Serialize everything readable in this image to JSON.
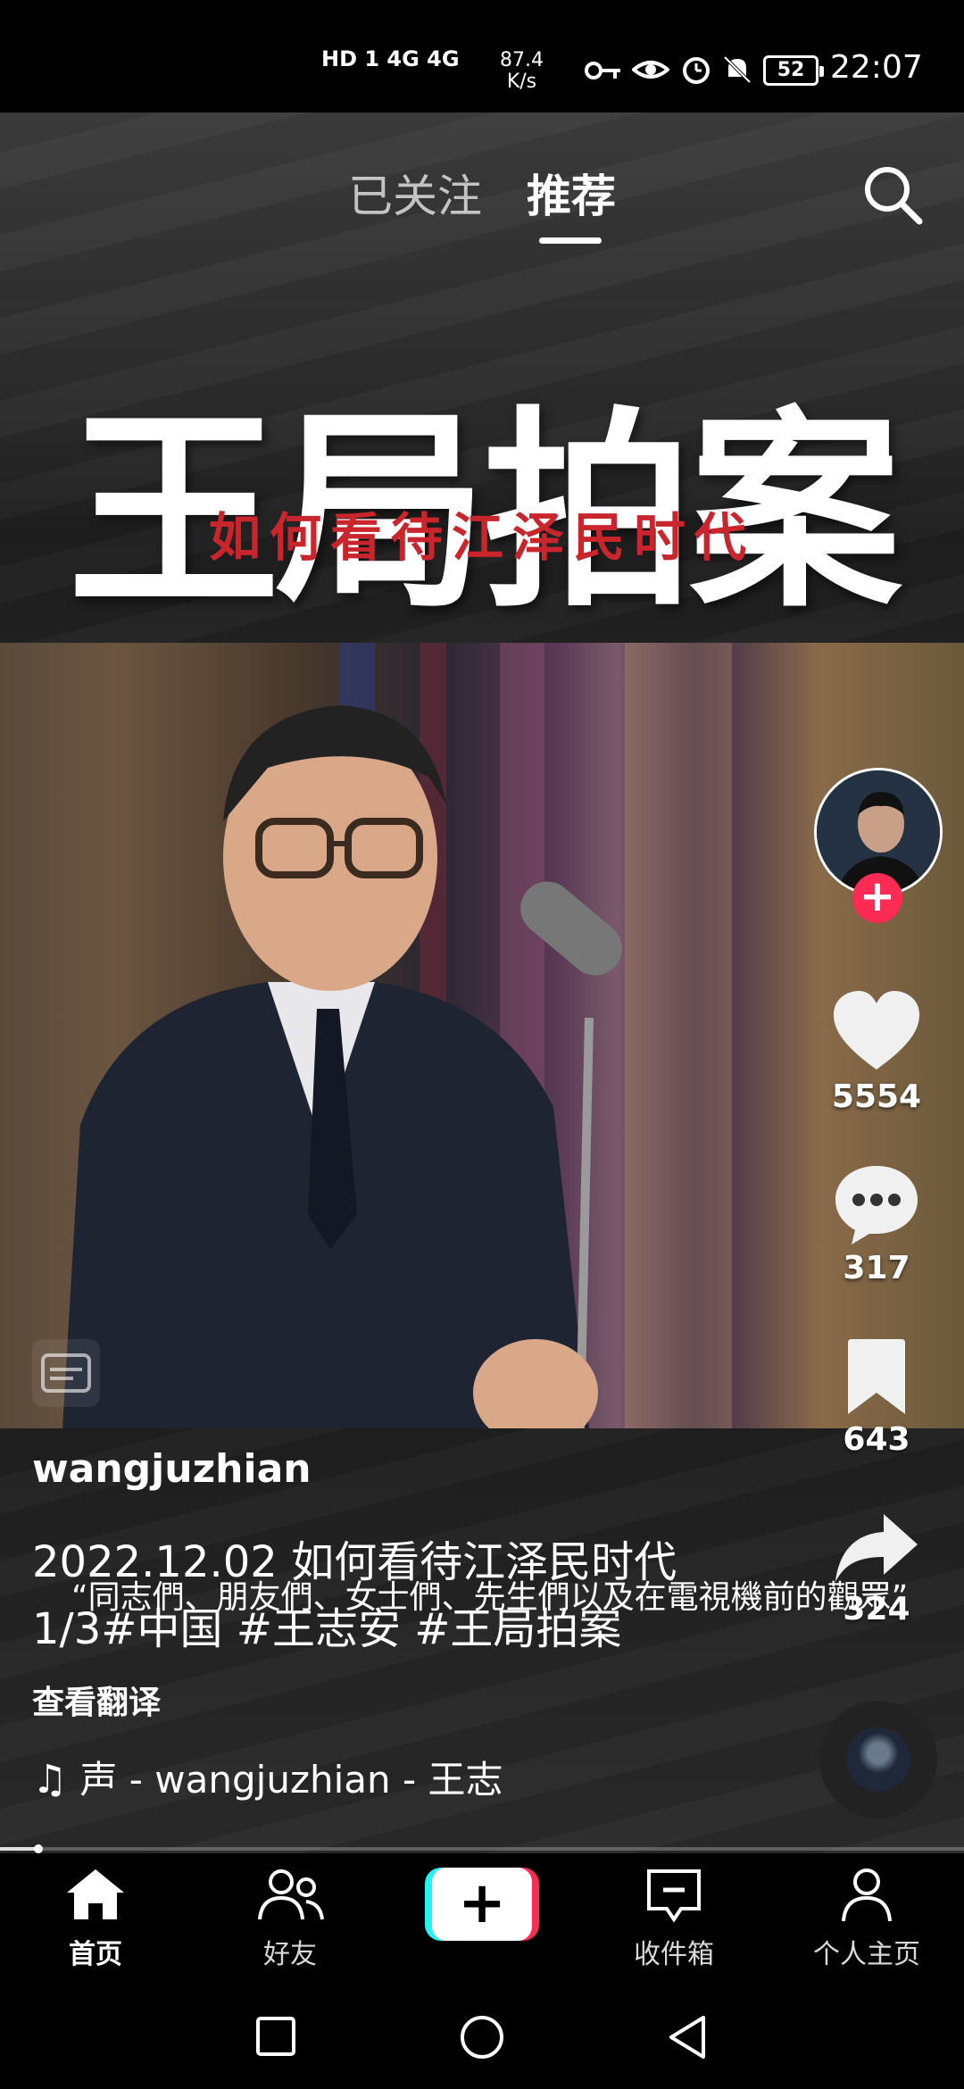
{
  "status_bar": {
    "network": "HD 1  4G  4G",
    "speed_value": "87.4",
    "speed_unit": "K/s",
    "battery": "52",
    "time": "22:07",
    "icons": [
      "key-icon",
      "eye-icon",
      "alarm-icon",
      "mute-icon"
    ]
  },
  "header": {
    "tab_following": "已关注",
    "tab_recommend": "推荐",
    "active_tab": "推荐"
  },
  "video": {
    "overlay_title": "王局拍案",
    "overlay_subtitle": "如何看待江泽民时代"
  },
  "actions": {
    "likes": "5554",
    "comments": "317",
    "favorites": "643",
    "shares": "324"
  },
  "post": {
    "username": "wangjuzhian",
    "caption_line1": "2022.12.02 如何看待江泽民时代",
    "caption_quote": "“同志們、朋友們、女士們、先生們以及在電視機前的觀眾”",
    "caption_line2": "1/3#中国 #王志安 #王局拍案",
    "translate": "查看翻译",
    "music": "声 - wangjuzhian - 王志"
  },
  "progress": {
    "fraction": 0.04
  },
  "bottom_nav": {
    "home": "首页",
    "friends": "好友",
    "inbox": "收件箱",
    "profile": "个人主页",
    "active": "首页"
  },
  "colors": {
    "accent": "#fe2c55",
    "cyan": "#25f4ee",
    "title_red": "#c9252c"
  }
}
